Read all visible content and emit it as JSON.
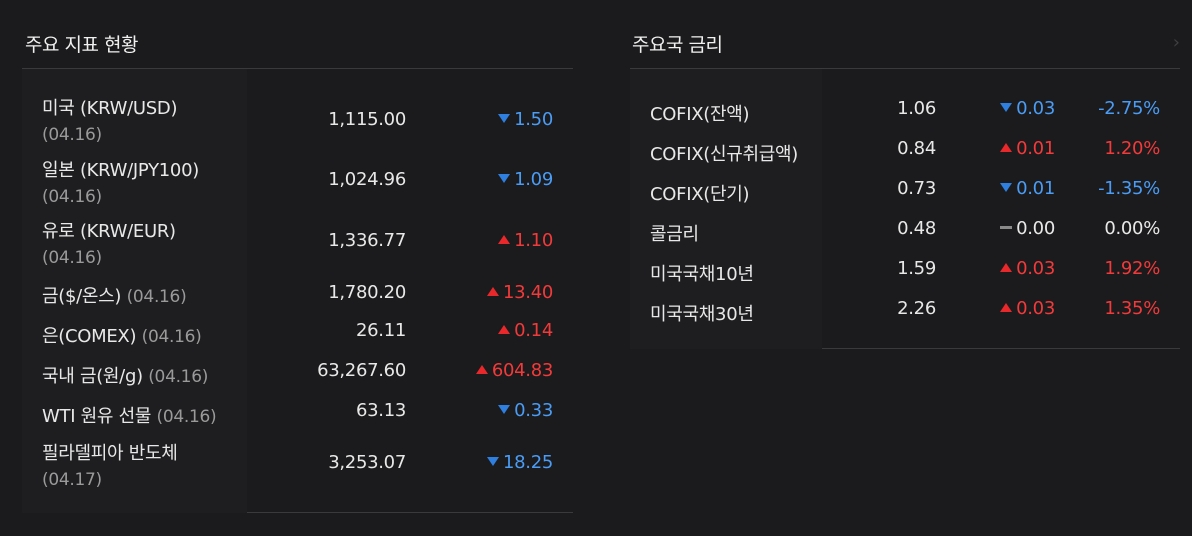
{
  "left_panel": {
    "title": "주요 지표 현황",
    "rows": [
      {
        "name": "미국 (KRW/USD)",
        "date": "(04.16)",
        "value": "1,115.00",
        "change": "1.50",
        "dir": "down"
      },
      {
        "name": "일본 (KRW/JPY100)",
        "date": "(04.16)",
        "value": "1,024.96",
        "change": "1.09",
        "dir": "down"
      },
      {
        "name": "유로 (KRW/EUR)",
        "date": "(04.16)",
        "value": "1,336.77",
        "change": "1.10",
        "dir": "up"
      },
      {
        "name": "금($/온스)",
        "date": "(04.16)",
        "value": "1,780.20",
        "change": "13.40",
        "dir": "up"
      },
      {
        "name": "은(COMEX)",
        "date": "(04.16)",
        "value": "26.11",
        "change": "0.14",
        "dir": "up"
      },
      {
        "name": "국내 금(원/g)",
        "date": "(04.16)",
        "value": "63,267.60",
        "change": "604.83",
        "dir": "up"
      },
      {
        "name": "WTI 원유 선물",
        "date": "(04.16)",
        "value": "63.13",
        "change": "0.33",
        "dir": "down"
      },
      {
        "name": "필라델피아 반도체",
        "date": "(04.17)",
        "value": "3,253.07",
        "change": "18.25",
        "dir": "down"
      }
    ]
  },
  "right_panel": {
    "title": "주요국 금리",
    "more_icon": "chevron-right-icon",
    "rows": [
      {
        "name": "COFIX(잔액)",
        "value": "1.06",
        "change": "0.03",
        "dir": "down",
        "pct": "-2.75%"
      },
      {
        "name": "COFIX(신규취급액)",
        "value": "0.84",
        "change": "0.01",
        "dir": "up",
        "pct": "1.20%"
      },
      {
        "name": "COFIX(단기)",
        "value": "0.73",
        "change": "0.01",
        "dir": "down",
        "pct": "-1.35%"
      },
      {
        "name": "콜금리",
        "value": "0.48",
        "change": "0.00",
        "dir": "flat",
        "pct": "0.00%"
      },
      {
        "name": "미국국채10년",
        "value": "1.59",
        "change": "0.03",
        "dir": "up",
        "pct": "1.92%"
      },
      {
        "name": "미국국채30년",
        "value": "2.26",
        "change": "0.03",
        "dir": "up",
        "pct": "1.35%"
      }
    ]
  },
  "colors": {
    "up": "#f23a3a",
    "down": "#4a9cf5",
    "background": "#1b1b1d"
  }
}
